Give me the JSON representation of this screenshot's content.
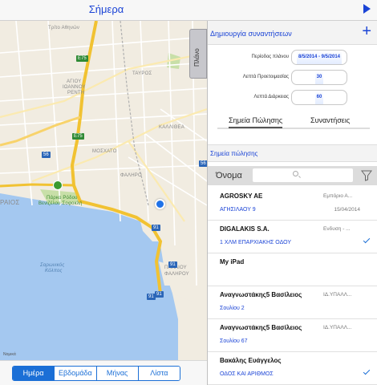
{
  "topbar": {
    "title": "Σήμερα",
    "play_icon": "play-icon"
  },
  "map": {
    "labels": {
      "trito": "Τρίτο Αθηνών",
      "agios": "ΑΓΙΟΥ",
      "ioannou": "ΙΩΑΝΝΟΥ",
      "rentis": "ΡΕΝΤΗ",
      "tavros": "ΤΑΥΡΟΣ",
      "kallithea": "ΚΑΛΛΙΘΕΑ",
      "moschato": "ΜΟΣΧΑΤΟ",
      "faliro": "ΦΑΛΗΡΟ",
      "raios": "ΡΑΙΟΣ",
      "paleo": "ΠΑΛΑΙΟΥ",
      "falirou": "ΦΑΛΗΡΟΥ",
      "park": "Πάρκο Ρόδου",
      "park2": "Βενιζέλου Σοφοκλή",
      "bay": "Σαρωνικός",
      "bay2": "Κόλπος",
      "legal": "Νομικά",
      "e75a": "E75",
      "e75b": "E75",
      "n56a": "56",
      "n56b": "56",
      "n91a": "91",
      "n91b": "91",
      "n91c": "91",
      "n91d": "91"
    },
    "plano": "Πλάνο"
  },
  "bottom": {
    "tabs": [
      "Ημέρα",
      "Εβδομάδα",
      "Μήνας",
      "Λίστα"
    ],
    "selected": "Ημέρα"
  },
  "panel": {
    "title": "Δημιουργία συναντήσεων",
    "add_icon": "plus-icon",
    "form": [
      {
        "label": "Περίοδος πλάνου",
        "value": "8/5/2014 - 9/5/2014"
      },
      {
        "label": "Λεπτά Προετοιμασίας",
        "value": "30"
      },
      {
        "label": "Λεπτά Διάρκειας",
        "value": "60"
      }
    ],
    "tabs": [
      "Σημεία Πώλησης",
      "Συναντήσεις"
    ],
    "section": "Σημεία πώλησης",
    "search": {
      "label": "Όνομα",
      "placeholder": ""
    },
    "items": [
      {
        "name": "AGROSKY AE",
        "role": "Εμπόριο Α...",
        "addr": "ΑΓΗΣΙΛΑΟΥ 9",
        "date": "15/04/2014",
        "checked": false
      },
      {
        "name": "DIGALAKIS S.A.",
        "role": "Ενδυση - ...",
        "addr": "1 ΧΛΜ ΕΠΑΡΧΙΑΚΗΣ ΟΔΟΥ",
        "date": "",
        "checked": true
      },
      {
        "name": "My iPad",
        "role": "",
        "addr": "",
        "date": "",
        "checked": false
      },
      {
        "name": "Αναγνωστάκης5 Βασίλειος",
        "role": "ΙΔ.ΥΠΑΛΛ...",
        "addr": "Σουλίου 2",
        "date": "",
        "checked": false
      },
      {
        "name": "Αναγνωστάκης5 Βασίλειος",
        "role": "ΙΔ.ΥΠΑΛΛ...",
        "addr": "Σουλίου 67",
        "date": "",
        "checked": false
      },
      {
        "name": "Βακάλης Ευάγγελος",
        "role": "",
        "addr": "ΟΔΟΣ ΚΑΙ ΑΡΙΘΜΟΣ",
        "date": "",
        "checked": true
      }
    ]
  },
  "colors": {
    "accent": "#1b44d6",
    "segment": "#1b6fd6",
    "sea": "#a4c8f0",
    "park": "#c8dfa8"
  }
}
